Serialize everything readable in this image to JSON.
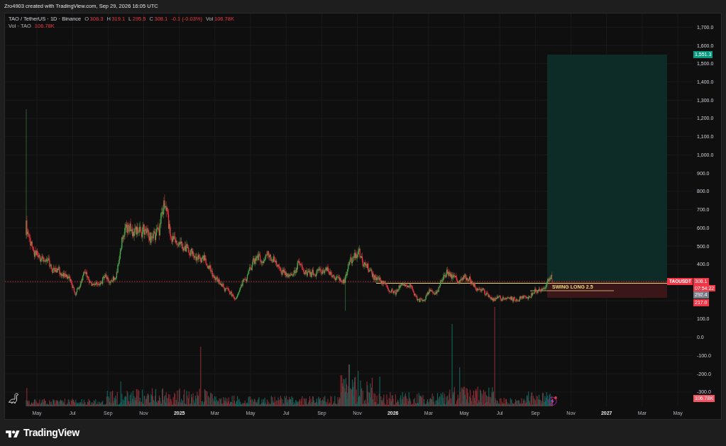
{
  "attribution": "Zro4903 created with TradingView.com, Sep 29, 2026 16:05 UTC",
  "legend": {
    "symbol": "TAO / TetherUS · 1D · Binance",
    "falling": true,
    "ohlc": [
      {
        "label": "O",
        "value": "308.3"
      },
      {
        "label": "H",
        "value": "319.1"
      },
      {
        "label": "L",
        "value": "295.5"
      },
      {
        "label": "C",
        "value": "308.1"
      }
    ],
    "change": "-0.1 (-0.03%)",
    "volume": {
      "label": "Vol",
      "value": "106.78K"
    }
  },
  "volume_legend": {
    "label": "Vol · TAO",
    "value": "106.78K"
  },
  "drawing": {
    "label": "SWING LONG 2.5"
  },
  "symbol_tag": "TAOUSDT",
  "price_axis": {
    "ticks": [
      "1,700.0",
      "1,600.0",
      "1,500.0",
      "1,400.0",
      "1,300.0",
      "1,200.0",
      "1,100.0",
      "1,000.0",
      "900.0",
      "800.0",
      "700.0",
      "600.0",
      "500.0",
      "400.0",
      "100.0",
      "0.0",
      "-100.0",
      "-200.0",
      "-300.0"
    ],
    "labels": [
      {
        "text": "1,551.3",
        "color": "#089981"
      },
      {
        "text": "308.1",
        "countdown": "07:54:22",
        "color": "#f23645"
      },
      {
        "text": "292.4",
        "color": "#787b86"
      },
      {
        "text": "217.0",
        "color": "#f23645"
      },
      {
        "text": "106.78K",
        "color": "#f7525f"
      }
    ]
  },
  "time_axis": {
    "ticks": [
      {
        "label": "May",
        "kind": "month"
      },
      {
        "label": "Jul",
        "kind": "month"
      },
      {
        "label": "Sep",
        "kind": "month"
      },
      {
        "label": "Nov",
        "kind": "month"
      },
      {
        "label": "2025",
        "kind": "year"
      },
      {
        "label": "Mar",
        "kind": "month"
      },
      {
        "label": "May",
        "kind": "month"
      },
      {
        "label": "Jul",
        "kind": "month"
      },
      {
        "label": "Sep",
        "kind": "month"
      },
      {
        "label": "Nov",
        "kind": "month"
      },
      {
        "label": "2026",
        "kind": "year"
      },
      {
        "label": "Mar",
        "kind": "month"
      },
      {
        "label": "May",
        "kind": "month"
      },
      {
        "label": "Jul",
        "kind": "month"
      },
      {
        "label": "Sep",
        "kind": "month"
      },
      {
        "label": "Nov",
        "kind": "month"
      },
      {
        "label": "2027",
        "kind": "year"
      },
      {
        "label": "Mar",
        "kind": "month"
      },
      {
        "label": "May",
        "kind": "month"
      }
    ]
  },
  "footer": {
    "brand": "TradingView"
  }
}
